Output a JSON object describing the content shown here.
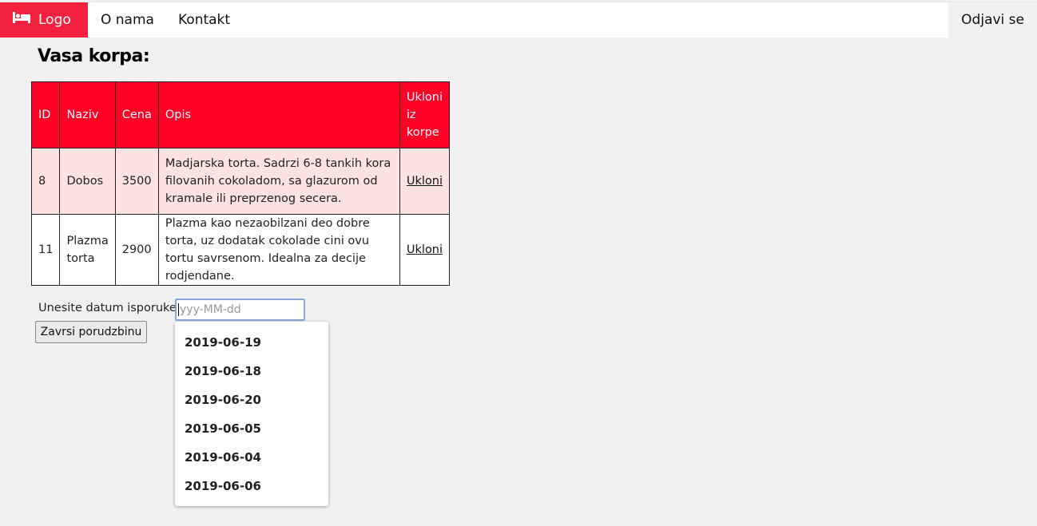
{
  "nav": {
    "logo_label": "Logo",
    "logo_icon": "bed-icon",
    "about_label": "O nama",
    "contact_label": "Kontakt",
    "logout_label": "Odjavi se",
    "brand_color": "#f5223f"
  },
  "page": {
    "title": "Vasa korpa:"
  },
  "table": {
    "header_color": "#ff0026",
    "headers": [
      "ID",
      "Naziv",
      "Cena",
      "Opis",
      "Ukloni iz korpe"
    ],
    "rows": [
      {
        "id": "8",
        "naziv": "Dobos",
        "cena": "3500",
        "opis": "Madjarska torta. Sadrzi 6-8 tankih kora filovanih cokoladom, sa glazurom od kramale ili preprzenog secera.",
        "ukloni": "Ukloni"
      },
      {
        "id": "11",
        "naziv": "Plazma torta",
        "cena": "2900",
        "opis": "Plazma kao nezaobilzani deo dobre torta, uz dodatak cokolade cini ovu tortu savrsenom. Idealna za decije rodjendane.",
        "ukloni": "Ukloni"
      }
    ]
  },
  "delivery": {
    "label": "Unesite datum isporuke:",
    "placeholder": "yyy-MM-dd",
    "submit_label": "Zavrsi porudzbinu",
    "suggestions": [
      "2019-06-19",
      "2019-06-18",
      "2019-06-20",
      "2019-06-05",
      "2019-06-04",
      "2019-06-06"
    ]
  }
}
